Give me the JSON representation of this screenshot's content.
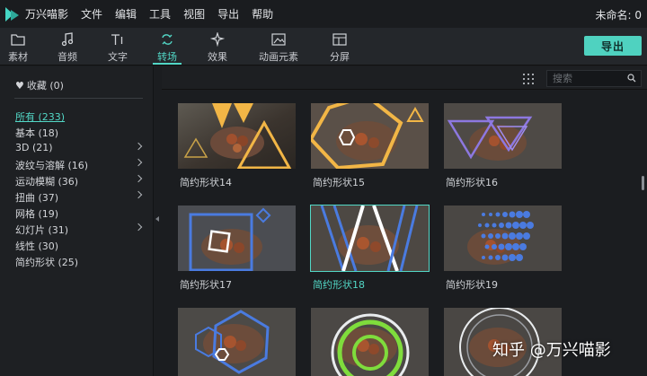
{
  "app": {
    "title": "万兴喵影",
    "doc_name": "未命名: 0"
  },
  "menu": [
    "文件",
    "编辑",
    "工具",
    "视图",
    "导出",
    "帮助"
  ],
  "toolbar": {
    "tabs": [
      {
        "label": "素材",
        "icon": "folder-icon"
      },
      {
        "label": "音频",
        "icon": "music-note-icon"
      },
      {
        "label": "文字",
        "icon": "text-icon"
      },
      {
        "label": "转场",
        "icon": "transition-icon",
        "active": true
      },
      {
        "label": "效果",
        "icon": "effects-icon"
      },
      {
        "label": "动画元素",
        "icon": "image-icon"
      },
      {
        "label": "分屏",
        "icon": "split-screen-icon"
      }
    ],
    "export_label": "导出"
  },
  "sidebar": {
    "favorites": "收藏 (0)",
    "categories": [
      {
        "label": "所有 (233)",
        "active": true,
        "arrow": false
      },
      {
        "label": "基本 (18)",
        "arrow": false
      },
      {
        "label": "3D (21)",
        "arrow": true
      },
      {
        "label": "波纹与溶解 (16)",
        "arrow": true
      },
      {
        "label": "运动模糊 (36)",
        "arrow": true
      },
      {
        "label": "扭曲 (37)",
        "arrow": true
      },
      {
        "label": "网格 (19)",
        "arrow": false
      },
      {
        "label": "幻灯片 (31)",
        "arrow": true
      },
      {
        "label": "线性 (30)",
        "arrow": false
      },
      {
        "label": "简约形状 (25)",
        "arrow": false
      }
    ]
  },
  "content": {
    "search_placeholder": "搜索",
    "items": [
      {
        "name": "简约形状14",
        "selected": false
      },
      {
        "name": "简约形状15",
        "selected": false
      },
      {
        "name": "简约形状16",
        "selected": false
      },
      {
        "name": "简约形状17",
        "selected": false
      },
      {
        "name": "简约形状18",
        "selected": true
      },
      {
        "name": "简约形状19",
        "selected": false
      },
      {
        "name": "",
        "selected": false
      },
      {
        "name": "",
        "selected": false
      },
      {
        "name": "",
        "selected": false
      }
    ]
  },
  "watermark": "知乎 @万兴喵影",
  "colors": {
    "accent": "#52d7c6",
    "background": "#1b1d20",
    "export_button": "#4fd2c0"
  }
}
